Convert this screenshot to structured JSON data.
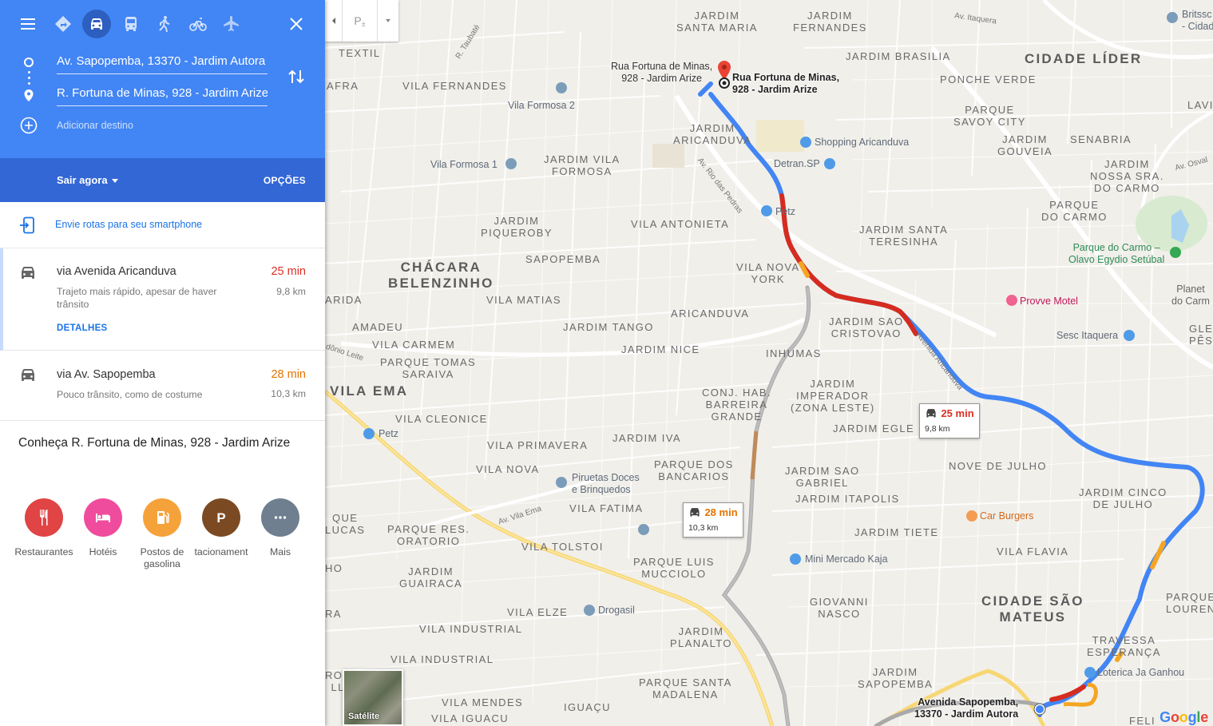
{
  "header": {
    "origin": "Av. Sapopemba, 13370 - Jardim Autora",
    "destination": "R. Fortuna de Minas, 928 - Jardim Arize",
    "add_destination": "Adicionar destino",
    "depart_label": "Sair agora",
    "options_label": "OPÇÕES",
    "active_mode": "car"
  },
  "send_to_phone": "Envie rotas para seu smartphone",
  "routes": [
    {
      "via": "via Avenida Aricanduva",
      "desc": "Trajeto mais rápido, apesar de haver trânsito",
      "time": "25 min",
      "dist": "9,8 km",
      "time_color": "#d93025",
      "details": "DETALHES"
    },
    {
      "via": "via Av. Sapopemba",
      "desc": "Pouco trânsito, como de costume",
      "time": "28 min",
      "dist": "10,3 km",
      "time_color": "#e37400"
    }
  ],
  "explore": {
    "title": "Conheça R. Fortuna de Minas, 928 - Jardim Arize",
    "categories": [
      {
        "label": "Restaurantes",
        "color": "#e04444",
        "icon": "restaurant-icon"
      },
      {
        "label": "Hotéis",
        "color": "#ef4c9d",
        "icon": "hotel-icon"
      },
      {
        "label": "Postos de gasolina",
        "color": "#f6a23a",
        "icon": "gas-station-icon"
      },
      {
        "label": "tacionament",
        "color": "#7c4a22",
        "icon": "parking-icon"
      },
      {
        "label": "Mais",
        "color": "#6f7f8f",
        "icon": "more-icon"
      }
    ]
  },
  "map": {
    "labels": {
      "jardim_santa_maria": "JARDIM\nSANTA MARIA",
      "jardim_fernandes": "JARDIM\nFERNANDES",
      "cidade_lider": "CIDADE LÍDER",
      "jardim_brasilia": "JARDIM BRASILIA",
      "ponche_verde": "PONCHE VERDE",
      "textil": "TEXTIL",
      "vila_fernandes": "VILA FERNANDES",
      "afra": "AFRA",
      "vila_formosa_2": "Vila Formosa 2",
      "parque_savoy": "PARQUE\nSAVOY CITY",
      "jardim_aricanduva": "JARDIM\nARICANDUVA",
      "shopping": "Shopping Aricanduva",
      "jardim_gouveia": "JARDIM\nGOUVEIA",
      "senabria": "SENABRIA",
      "vila_formosa_1": "Vila Formosa 1",
      "jardim_vila_formosa": "JARDIM VILA\nFORMOSA",
      "detran": "Detran.SP",
      "jardim_nossa_sra": "JARDIM\nNOSSA SRA.\nDO CARMO",
      "parque_do_carmo": "PARQUE\nDO CARMO",
      "jardim_piqueroby": "JARDIM\nPIQUEROBY",
      "vila_antonieta": "VILA ANTONIETA",
      "petz": "Petz",
      "jardim_santa_teresinha": "JARDIM SANTA\nTERESINHA",
      "chacara_belenzinho": "CHÁCARA\nBELENZINHO",
      "sapopemba": "SAPOPEMBA",
      "vila_nova_york": "VILA NOVA\nYORK",
      "parque_carmo_olavo": "Parque do Carmo –\nOlavo Egydio Setúbal",
      "arida": "ARIDA",
      "vila_matias": "VILA MATIAS",
      "aricanduva": "ARICANDUVA",
      "provve_motel": "Provve Motel",
      "amadeu": "AMADEU",
      "jardim_tango": "JARDIM TANGO",
      "jardim_sao_cristovao": "JARDIM SAO\nCRISTOVAO",
      "sesc_itaquera": "Sesc Itaquera",
      "vila_carmem": "VILA CARMEM",
      "jardim_nice": "JARDIM NICE",
      "inhumas": "INHUMAS",
      "parque_tomas_saraiva": "PARQUE TOMAS\nSARAIVA",
      "vila_ema": "VILA EMA",
      "conj_hab": "CONJ. HAB.\nBARREIRA\nGRANDE",
      "jardim_imperador": "JARDIM\nIMPERADOR\n(ZONA LESTE)",
      "vila_cleonice": "VILA CLEONICE",
      "jardim_egle": "JARDIM EGLE",
      "petz_2": "Petz",
      "jardim_iva": "JARDIM IVA",
      "vila_primavera": "VILA PRIMAVERA",
      "nove_de_julho": "NOVE DE JULHO",
      "vila_nova": "VILA NOVA",
      "parque_dos_bancarios": "PARQUE DOS\nBANCARIOS",
      "jardim_sao_gabriel": "JARDIM SAO\nGABRIEL",
      "jardim_cinco_julho": "JARDIM CINCO\nDE JULHO",
      "piruetas": "Piruetas Doces\ne Brinquedos",
      "jardim_itapolis": "JARDIM ITAPOLIS",
      "vila_fatima": "VILA FATIMA",
      "car_burgers": "Car Burgers",
      "parque_res_oratorio": "PARQUE RES.\nORATORIO",
      "jardim_tiete": "JARDIM TIETE",
      "vila_tolstoi": "VILA TOLSTOI",
      "vila_flavia": "VILA FLAVIA",
      "parque_luis_mucciolo": "PARQUE LUIS\nMUCCIOLO",
      "mini_mercado": "Mini Mercado Kaja",
      "jardim_guairaca": "JARDIM\nGUAIRACA",
      "cidade_sao_mateus": "CIDADE SÃO\nMATEUS",
      "giovanni_nasco": "GIOVANNI\nNASCO",
      "vila_elze": "VILA ELZE",
      "drogasil": "Drogasil",
      "jardim_planalto": "JARDIM\nPLANALTO",
      "travessa_esperanca": "TRAVESSA\nESPERANÇA",
      "vila_industrial_1": "VILA INDUSTRIAL",
      "vila_industrial_2": "VILA INDUSTRIAL",
      "loterica": "Loterica Ja Ganhou",
      "jardim_sapopemba": "JARDIM\nSAPOPEMBA",
      "parque_santa_madalena": "PARQUE SANTA\nMADALENA",
      "vila_mendes": "VILA MENDES",
      "iguacu": "IGUAÇU",
      "vila_iguacu": "VILA IGUACU",
      "parque_louren": "PARQUE\nLOUREN",
      "planet_do_carm": "Planet\ndo Carm",
      "glebe_pes": "GLE\nPÊS",
      "lavios": "LAVIOS",
      "brittsc": "Britssc\n- Cidad",
      "felic": "FELI",
      "rosa_lla": "ROSA\nLLA",
      "que_lucas": "QUE\nLUCAS",
      "ho": "HO",
      "ra": "RA",
      "av_itaquera": "Av. Itaquera",
      "r_taubate": "R. Taubaté",
      "av_rio_das_pedras": "Av. Rio das Pedras",
      "avenida_aricanduva": "Avenida Aricanduva",
      "av_vila_ema": "Av. Vila Ema",
      "donio_leite": "dônio Leite",
      "av_osval": "Av. Osval"
    },
    "gray_dest_label": "Rua Fortuna de Minas,\n928 - Jardim Arize",
    "dest_label": "Rua Fortuna de Minas,\n928 - Jardim Arize",
    "origin_label": "Avenida Sapopemba,\n13370 - Jardim Autora",
    "route_box_1": {
      "time": "25 min",
      "dist": "9,8 km",
      "color": "#d93025"
    },
    "route_box_2": {
      "time": "28 min",
      "dist": "10,3 km",
      "color": "#e37400"
    },
    "parking_toggle": "P",
    "satellite_label": "Satélite",
    "google_logo": "Google"
  }
}
